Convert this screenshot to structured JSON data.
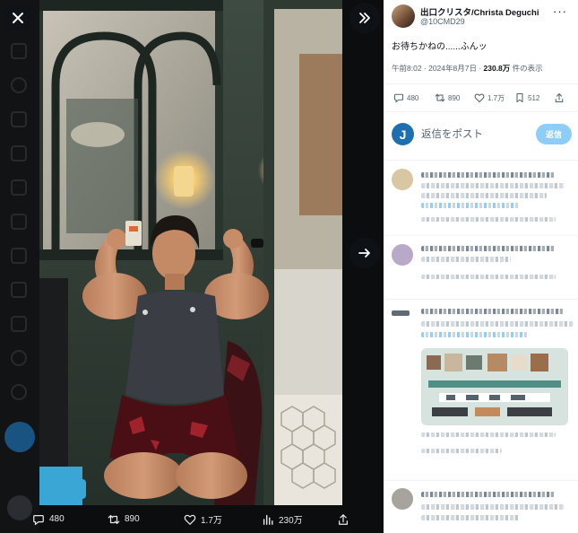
{
  "post": {
    "author_name": "出口クリスタ/Christa Deguchi",
    "author_handle": "@10CMD29",
    "text": "お待ちかねの......ふんッ",
    "time": "午前8:02 · 2024年8月7日 · ",
    "views_count": "230.8万",
    "views_suffix": " 件の表示"
  },
  "stats": {
    "replies": "480",
    "reposts": "890",
    "likes": "1.7万",
    "bookmarks": "512"
  },
  "reply_box": {
    "avatar_letter": "J",
    "placeholder": "返信をポスト",
    "button_label": "返信"
  },
  "media_actions": {
    "replies": "480",
    "reposts": "890",
    "likes": "1.7万",
    "views": "230万"
  },
  "icons": [
    "close-icon",
    "expand-icon",
    "next-arrow-icon",
    "more-icon",
    "reply-icon",
    "repost-icon",
    "like-icon",
    "bookmark-icon",
    "share-icon",
    "views-icon"
  ],
  "colors": {
    "accent": "#1d9bf0",
    "reply_button": "#8ecdf8",
    "viewer_bg": "#0c0d0e"
  }
}
